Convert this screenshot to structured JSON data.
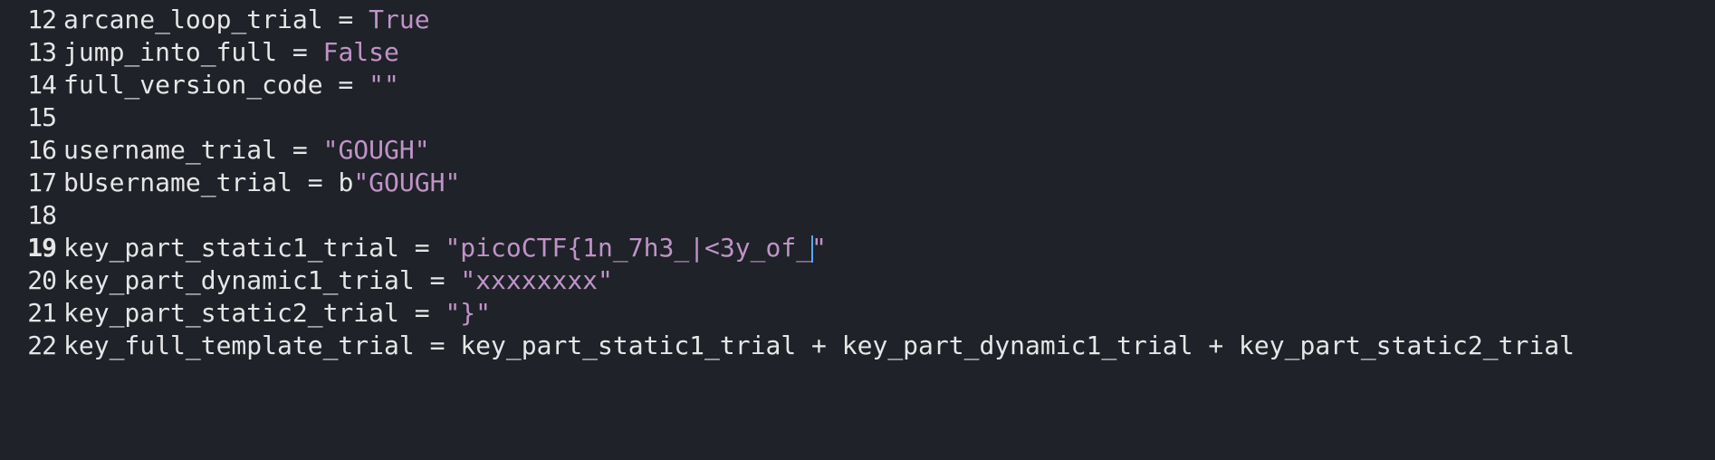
{
  "colors": {
    "background": "#1f2229",
    "text": "#e6e6e6",
    "string_and_constant": "#c093c7",
    "cursor": "#5aa7ff"
  },
  "lines": [
    {
      "number": "12",
      "ident": "arcane_loop_trial",
      "op": " = ",
      "prefix": "",
      "value": "True",
      "kind": "const"
    },
    {
      "number": "13",
      "ident": "jump_into_full",
      "op": " = ",
      "prefix": "",
      "value": "False",
      "kind": "const"
    },
    {
      "number": "14",
      "ident": "full_version_code",
      "op": " = ",
      "prefix": "",
      "value": "\"\"",
      "kind": "str"
    },
    {
      "number": "15",
      "ident": "",
      "op": "",
      "prefix": "",
      "value": "",
      "kind": "empty"
    },
    {
      "number": "16",
      "ident": "username_trial",
      "op": " = ",
      "prefix": "",
      "value": "\"GOUGH\"",
      "kind": "str"
    },
    {
      "number": "17",
      "ident": "bUsername_trial",
      "op": " = ",
      "prefix": "b",
      "value": "\"GOUGH\"",
      "kind": "str"
    },
    {
      "number": "18",
      "ident": "",
      "op": "",
      "prefix": "",
      "value": "",
      "kind": "empty"
    },
    {
      "number": "19",
      "ident": "key_part_static1_trial",
      "op": " = ",
      "prefix": "",
      "value_before_cursor": "\"picoCTF{1n_7h3_|<3y_of_",
      "value_after_cursor": "\"",
      "kind": "str-cursor"
    },
    {
      "number": "20",
      "ident": "key_part_dynamic1_trial",
      "op": " = ",
      "prefix": "",
      "value": "\"xxxxxxxx\"",
      "kind": "str"
    },
    {
      "number": "21",
      "ident": "key_part_static2_trial",
      "op": " = ",
      "prefix": "",
      "value": "\"}\"",
      "kind": "str"
    },
    {
      "number": "22",
      "ident": "key_full_template_trial",
      "op": " = ",
      "prefix": "",
      "value": "key_part_static1_trial + key_part_dynamic1_trial + key_part_static2_trial",
      "kind": "plain"
    }
  ]
}
